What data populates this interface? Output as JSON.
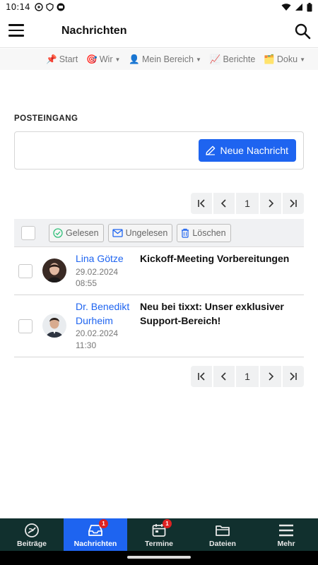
{
  "status_bar": {
    "time": "10:14"
  },
  "app_bar": {
    "title": "Nachrichten"
  },
  "top_nav": [
    {
      "icon": "📌",
      "label": "Start",
      "dropdown": false
    },
    {
      "icon": "🎯",
      "label": "Wir",
      "dropdown": true
    },
    {
      "icon": "👤",
      "label": "Mein Bereich",
      "dropdown": true
    },
    {
      "icon": "📈",
      "label": "Berichte",
      "dropdown": false
    },
    {
      "icon": "🗂️",
      "label": "Doku",
      "dropdown": true
    }
  ],
  "inbox": {
    "title": "POSTEINGANG",
    "new_button_label": "Neue Nachricht",
    "current_page": "1",
    "actions": {
      "read_label": "Gelesen",
      "unread_label": "Ungelesen",
      "delete_label": "Löschen"
    },
    "messages": [
      {
        "sender_line1": "Lina Götze",
        "sender_line2": "",
        "date": "29.02.2024",
        "time": "08:55",
        "subject_line1": "Kickoff-Meeting Vorbereitungen",
        "subject_line2": ""
      },
      {
        "sender_line1": "Dr. Benedikt",
        "sender_line2": "Durheim",
        "date": "20.02.2024",
        "time": "11:30",
        "subject_line1": "Neu bei tixxt: Unser exklusiver",
        "subject_line2": "Support-Bereich!"
      }
    ]
  },
  "bottom_nav": [
    {
      "label": "Beiträge",
      "icon": "feed-icon",
      "badge": ""
    },
    {
      "label": "Nachrichten",
      "icon": "inbox-icon",
      "badge": "1"
    },
    {
      "label": "Termine",
      "icon": "calendar-icon",
      "badge": "1"
    },
    {
      "label": "Dateien",
      "icon": "folder-icon",
      "badge": ""
    },
    {
      "label": "Mehr",
      "icon": "menu-icon",
      "badge": ""
    }
  ],
  "colors": {
    "accent": "#1e64f0",
    "bottom_nav_bg": "#11302e",
    "badge": "#dd2222"
  }
}
